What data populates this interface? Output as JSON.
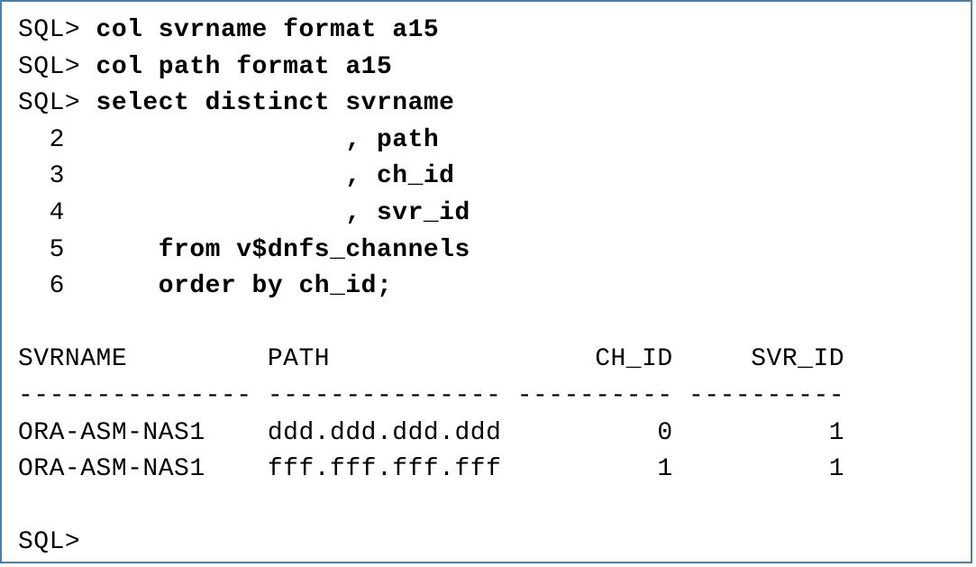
{
  "terminal": {
    "prompt": "SQL>",
    "final_prompt": "SQL>",
    "lines": [
      {
        "prefix": "SQL> ",
        "bold": "col svrname format a15"
      },
      {
        "prefix": "SQL> ",
        "bold": "col path format a15"
      },
      {
        "prefix": "SQL> ",
        "bold": "select distinct svrname"
      },
      {
        "prefix": "  2                  ",
        "bold": ", path"
      },
      {
        "prefix": "  3                  ",
        "bold": ", ch_id"
      },
      {
        "prefix": "  4                  ",
        "bold": ", svr_id"
      },
      {
        "prefix": "  5      ",
        "bold": "from v$dnfs_channels"
      },
      {
        "prefix": "  6      ",
        "bold": "order by ch_id;"
      }
    ],
    "blank": "",
    "header": "SVRNAME         PATH                 CH_ID     SVR_ID",
    "divider": "--------------- --------------- ---------- ----------",
    "rows": [
      "ORA-ASM-NAS1    ddd.ddd.ddd.ddd          0          1",
      "ORA-ASM-NAS1    fff.fff.fff.fff          1          1"
    ]
  }
}
